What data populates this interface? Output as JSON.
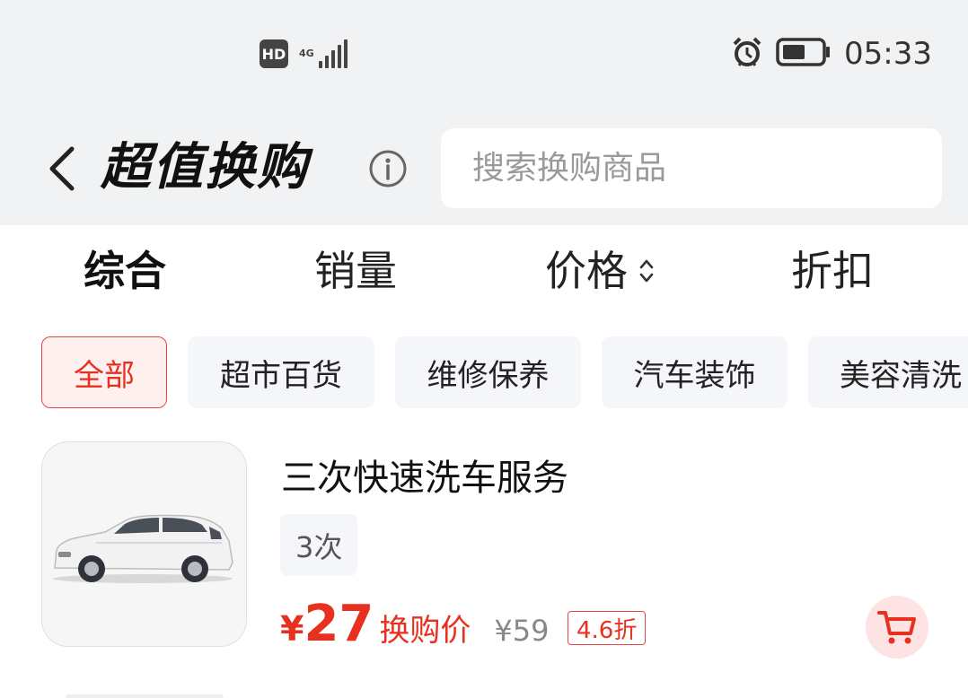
{
  "status_bar": {
    "hd_label": "HD",
    "network_label": "4G",
    "time": "05:33",
    "icons": [
      "hd-icon",
      "signal-icon",
      "alarm-icon",
      "battery-icon"
    ]
  },
  "header": {
    "title": "超值换购",
    "search_placeholder": "搜索换购商品",
    "icons": [
      "back-arrow-icon",
      "info-icon"
    ]
  },
  "sort_tabs": [
    {
      "label": "综合",
      "active": true
    },
    {
      "label": "销量",
      "active": false
    },
    {
      "label": "价格",
      "active": false
    },
    {
      "label": "折扣",
      "active": false
    }
  ],
  "category_chips": [
    {
      "label": "全部",
      "active": true
    },
    {
      "label": "超市百货",
      "active": false
    },
    {
      "label": "维修保养",
      "active": false
    },
    {
      "label": "汽车装饰",
      "active": false
    },
    {
      "label": "美容清洗",
      "active": false
    }
  ],
  "products": [
    {
      "name": "三次快速洗车服务",
      "spec": "3次",
      "currency": "¥",
      "price": "27",
      "price_label": "换购价",
      "original_price": "¥59",
      "discount": "4.6折",
      "image": "white-suv-image"
    }
  ],
  "colors": {
    "accent_red": "#e8301f",
    "header_bg": "#f1f2f4",
    "chip_bg": "#f5f6f9"
  }
}
